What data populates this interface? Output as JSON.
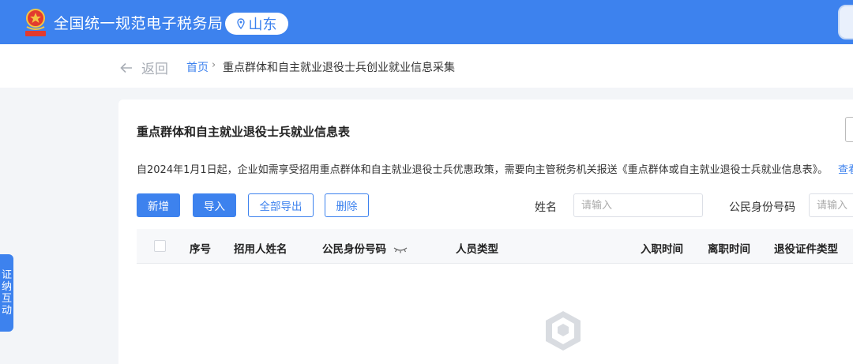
{
  "header": {
    "site_title": "全国统一规范电子税务局",
    "region": "山东",
    "emblem_icon": "tax-emblem-icon",
    "accent_color": "#3d82ee"
  },
  "breadcrumb": {
    "back_label": "返回",
    "home": "首页",
    "separator": "›",
    "current": "重点群体和自主就业退役士兵创业就业信息采集"
  },
  "side_tab": {
    "chars": [
      "证",
      "纳",
      "互",
      "动"
    ]
  },
  "card": {
    "title": "重点群体和自主就业退役士兵就业信息表",
    "notice": "自2024年1月1日起，企业如需享受招用重点群体和自主就业退役士兵优惠政策，需要向主管税务机关报送《重点群体或自主就业退役士兵就业信息表》。",
    "notice_link": "查看"
  },
  "toolbar": {
    "add_label": "新增",
    "import_label": "导入",
    "export_all_label": "全部导出",
    "delete_label": "删除"
  },
  "filters": {
    "name_label": "姓名",
    "name_placeholder": "请输入",
    "id_label": "公民身份号码",
    "id_placeholder": "请输入"
  },
  "table": {
    "columns": [
      "序号",
      "招用人姓名",
      "公民身份号码",
      "人员类型",
      "入职时间",
      "离职时间",
      "退役证件类型"
    ],
    "rows": []
  }
}
